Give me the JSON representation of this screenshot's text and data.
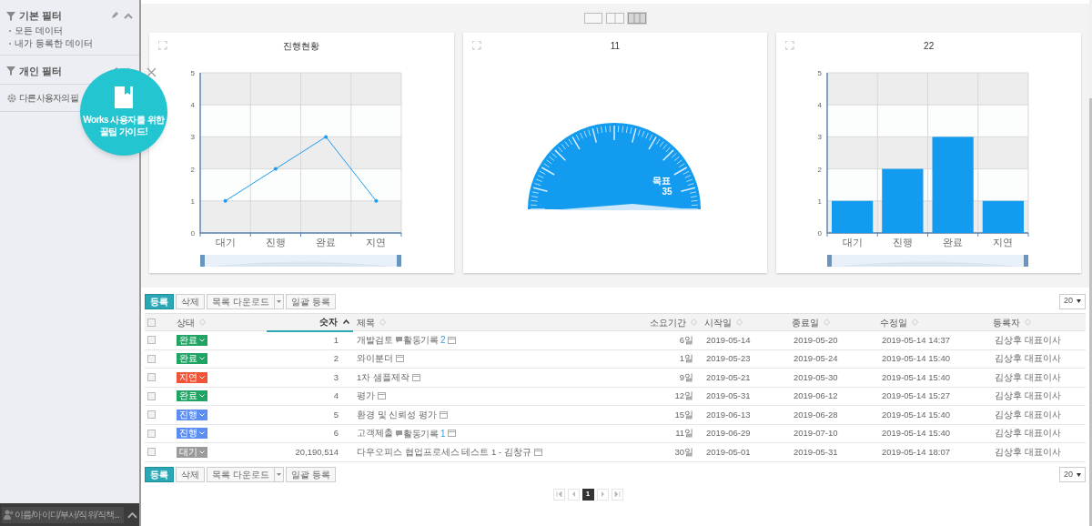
{
  "sidebar": {
    "sections": [
      {
        "title": "기본 필터",
        "items": [
          "모든 데이터",
          "내가 등록한 데이터"
        ]
      },
      {
        "title": "개인 필터"
      }
    ],
    "other_users_filter": "다른 사용자의 필",
    "user_search": {
      "placeholder": "이름/아이디/부서/직위/직책..."
    }
  },
  "guide_popup": {
    "lines": [
      "Works 사용자를 위한",
      "꿀팁 가이드!"
    ]
  },
  "layout_options": [
    {
      "selected": false
    },
    {
      "selected": false
    },
    {
      "selected": true
    }
  ],
  "cards": [
    {
      "kind": "line",
      "title": "진행현황",
      "chart_data": {
        "type": "line",
        "categories": [
          "대기",
          "진행",
          "완료",
          "지연"
        ],
        "series": [
          {
            "color": "#1a9cf0",
            "values": [
              1,
              2,
              3,
              1
            ]
          }
        ],
        "ylim": [
          0,
          5
        ],
        "yticks": [
          0,
          1,
          2,
          3,
          4,
          5
        ],
        "grid": true
      }
    },
    {
      "kind": "gauge",
      "title": "11",
      "target_label": "목표",
      "target_value": "35"
    },
    {
      "kind": "bar",
      "title": "22",
      "chart_data": {
        "type": "bar",
        "categories": [
          "대기",
          "진행",
          "완료",
          "지연"
        ],
        "series": [
          {
            "color": "#129bef",
            "values": [
              1,
              2,
              3,
              1
            ]
          }
        ],
        "ylim": [
          0,
          5
        ],
        "yticks": [
          0,
          1,
          2,
          3,
          4,
          5
        ],
        "grid": true
      }
    }
  ],
  "toolbars": [
    {
      "buttons": [
        "등록",
        "삭제",
        "목록 다운로드",
        "일괄 등록"
      ],
      "page_size": "20"
    },
    {
      "buttons": [
        "등록",
        "삭제",
        "목록 다운로드",
        "일괄 등록"
      ],
      "page_size": "20"
    }
  ],
  "table": {
    "all_checked": false,
    "columns": [
      {
        "label": "상태",
        "sorted": false
      },
      {
        "label": "숫자",
        "sorted": true
      },
      {
        "label": "제목",
        "sorted": false
      },
      {
        "label": "소요기간",
        "sorted": false
      },
      {
        "label": "시작일",
        "sorted": false
      },
      {
        "label": "종료일",
        "sorted": false
      },
      {
        "label": "수정일",
        "sorted": false
      },
      {
        "label": "등록자",
        "sorted": false
      }
    ],
    "rows": [
      {
        "checked": false,
        "status": {
          "label": "완료",
          "color": "#1fa463"
        },
        "number": "1",
        "title": "개발검토",
        "activity": {
          "label": "활동기록",
          "count": "2"
        },
        "duration": "6일",
        "start": "2019-05-14",
        "end": "2019-05-20",
        "modified": "2019-05-14 14:37",
        "author": "김상후 대표이사"
      },
      {
        "checked": false,
        "status": {
          "label": "완료",
          "color": "#1fa463"
        },
        "number": "2",
        "title": "와이분더",
        "duration": "1일",
        "start": "2019-05-23",
        "end": "2019-05-24",
        "modified": "2019-05-14 15:40",
        "author": "김상후 대표이사"
      },
      {
        "checked": false,
        "status": {
          "label": "지연",
          "color": "#f05438"
        },
        "number": "3",
        "title": "1차 샘플제작",
        "duration": "9일",
        "start": "2019-05-21",
        "end": "2019-05-30",
        "modified": "2019-05-14 15:40",
        "author": "김상후 대표이사"
      },
      {
        "checked": false,
        "status": {
          "label": "완료",
          "color": "#1fa463"
        },
        "number": "4",
        "title": "평가",
        "duration": "12일",
        "start": "2019-05-31",
        "end": "2019-06-12",
        "modified": "2019-05-14 15:27",
        "author": "김상후 대표이사"
      },
      {
        "checked": false,
        "status": {
          "label": "진행",
          "color": "#5b8ef0"
        },
        "number": "5",
        "title": "환경 및 신뢰성 평가",
        "duration": "15일",
        "start": "2019-06-13",
        "end": "2019-06-28",
        "modified": "2019-05-14 15:40",
        "author": "김상후 대표이사"
      },
      {
        "checked": false,
        "status": {
          "label": "진행",
          "color": "#5b8ef0"
        },
        "number": "6",
        "title": "고객제출",
        "activity": {
          "label": "활동기록",
          "count": "1"
        },
        "duration": "11일",
        "start": "2019-06-29",
        "end": "2019-07-10",
        "modified": "2019-05-14 15:40",
        "author": "김상후 대표이사"
      },
      {
        "checked": false,
        "status": {
          "label": "대기",
          "color": "#9b9b9b"
        },
        "number": "20,190,514",
        "title": "다우오피스 협업프로세스 테스트 1 - 김창규",
        "duration": "30일",
        "start": "2019-05-01",
        "end": "2019-05-31",
        "modified": "2019-05-14 18:07",
        "author": "김상후 대표이사"
      }
    ]
  },
  "pagination": {
    "pages": [
      {
        "label": "1",
        "selected": true
      }
    ]
  }
}
